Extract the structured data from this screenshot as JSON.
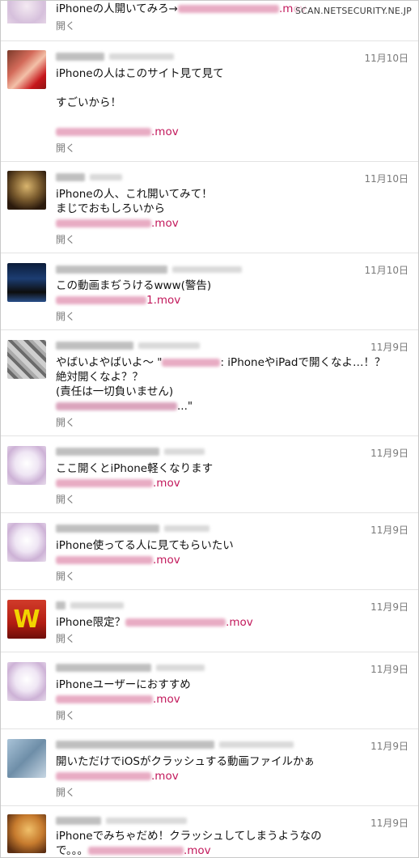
{
  "watermark": "SCAN.NETSECURITY.NE.JP",
  "open_label": "開く",
  "colors": {
    "link": "#c2185b",
    "date": "#7a7a7a",
    "divider": "#e3e3e3"
  },
  "top_partial": {
    "text": "iPhoneの人開いてみろ→",
    "suffix": ".mov",
    "open": "開く"
  },
  "tweets": [
    {
      "date": "11月10日",
      "line1": "iPhoneの人はこのサイト見て見て",
      "line2": "",
      "line3": "すごいから！",
      "link_suffix": ".mov",
      "avatar": "avatar-anime-red"
    },
    {
      "date": "11月10日",
      "line1": "iPhoneの人、これ開いてみて！",
      "line2": "まじでおもしろいから",
      "link_suffix": ".mov",
      "avatar": "avatar-dog"
    },
    {
      "date": "11月10日",
      "line1": "この動画まぢうけるwww(警告)",
      "link_suffix": "1.mov",
      "avatar": "avatar-dark"
    },
    {
      "date": "11月9日",
      "line1": "やばいよやばいよ～ \"",
      "line1b": ": iPhoneやiPadで開くなよ…！？",
      "line2": "絶対開くなよ？？",
      "line3": "(責任は一切負いません)",
      "line4_suffix": "...\"",
      "avatar": "avatar-pattern"
    },
    {
      "date": "11月9日",
      "line1": "ここ開くとiPhone軽くなります",
      "link_suffix": ".mov",
      "avatar": "avatar-anime-white"
    },
    {
      "date": "11月9日",
      "line1": "iPhone使ってる人に見てもらいたい",
      "link_suffix": ".mov",
      "avatar": "avatar-anime-white"
    },
    {
      "date": "11月9日",
      "line1": "iPhone限定？",
      "link_suffix": ".mov",
      "avatar": "avatar-w-logo",
      "avatar_text": "W"
    },
    {
      "date": "11月9日",
      "line1": "iPhoneユーザーにおすすめ",
      "link_suffix": ".mov",
      "avatar": "avatar-anime-white"
    },
    {
      "date": "11月9日",
      "line1": "開いただけでiOSがクラッシュする動画ファイルかぁ",
      "link_suffix": ".mov",
      "avatar": "avatar-sketch"
    },
    {
      "date": "11月9日",
      "line1": "iPhoneでみちゃだめ！クラッシュしてしまうようなの",
      "line2": "で。。。",
      "link_suffix": ".mov",
      "avatar": "avatar-person"
    }
  ]
}
